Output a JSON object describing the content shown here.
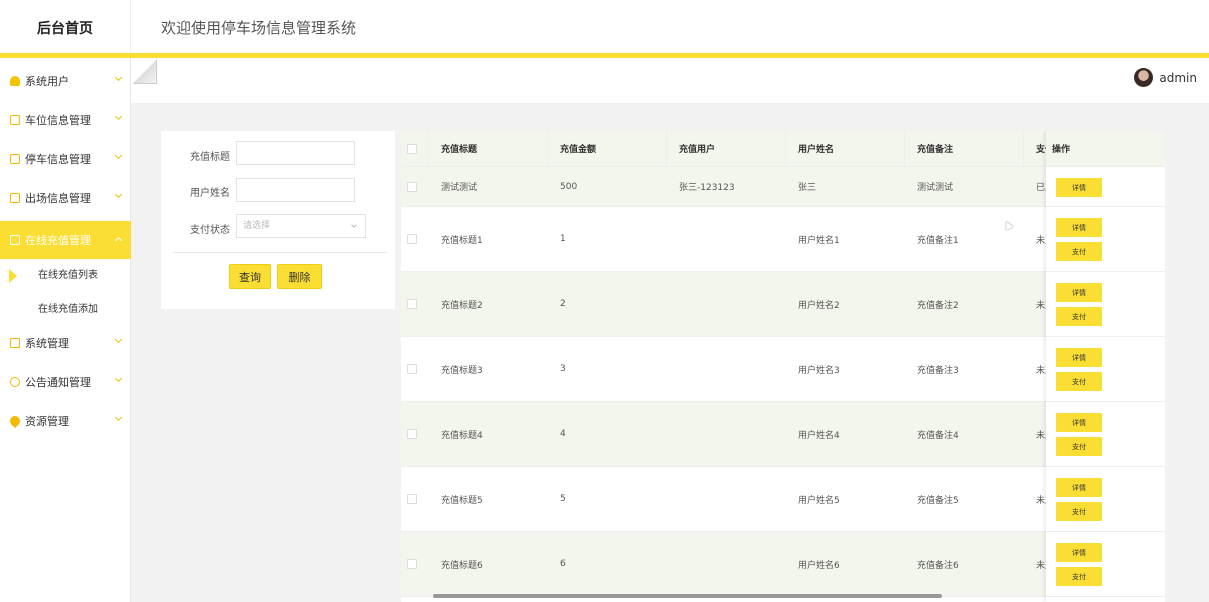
{
  "header": {
    "logo_text": "后台首页",
    "site_title": "欢迎使用停车场信息管理系统"
  },
  "user": {
    "name": "admin"
  },
  "sidebar": {
    "items": [
      {
        "label": "系统用户",
        "icon": "user-icon"
      },
      {
        "label": "车位信息管理",
        "icon": "square-icon"
      },
      {
        "label": "停车信息管理",
        "icon": "square-icon"
      },
      {
        "label": "出场信息管理",
        "icon": "square-icon"
      },
      {
        "label": "在线充值管理",
        "icon": "square-icon",
        "active": true
      },
      {
        "label": "系统管理",
        "icon": "image-icon"
      },
      {
        "label": "公告通知管理",
        "icon": "info-icon"
      },
      {
        "label": "资源管理",
        "icon": "pin-icon"
      }
    ],
    "sub_items": [
      {
        "label": "在线充值列表",
        "active": true
      },
      {
        "label": "在线充值添加"
      }
    ]
  },
  "search": {
    "title_label": "充值标题",
    "username_label": "用户姓名",
    "pay_status_label": "支付状态",
    "pay_status_placeholder": "请选择",
    "query_button": "查询",
    "delete_button": "删除"
  },
  "table": {
    "headers": [
      "充值标题",
      "充值金额",
      "充值用户",
      "用户姓名",
      "充值备注",
      "支付",
      "操作"
    ],
    "rows": [
      {
        "title": "测试测试",
        "amount": "500",
        "user": "张三-123123",
        "name": "张三",
        "remark": "测试测试",
        "pay": "已支",
        "actions": [
          "详情"
        ]
      },
      {
        "title": "充值标题1",
        "amount": "1",
        "user": "",
        "name": "用户姓名1",
        "remark": "充值备注1",
        "pay": "未支",
        "actions": [
          "详情",
          "支付"
        ]
      },
      {
        "title": "充值标题2",
        "amount": "2",
        "user": "",
        "name": "用户姓名2",
        "remark": "充值备注2",
        "pay": "未支",
        "actions": [
          "详情",
          "支付"
        ]
      },
      {
        "title": "充值标题3",
        "amount": "3",
        "user": "",
        "name": "用户姓名3",
        "remark": "充值备注3",
        "pay": "未支",
        "actions": [
          "详情",
          "支付"
        ]
      },
      {
        "title": "充值标题4",
        "amount": "4",
        "user": "",
        "name": "用户姓名4",
        "remark": "充值备注4",
        "pay": "未支",
        "actions": [
          "详情",
          "支付"
        ]
      },
      {
        "title": "充值标题5",
        "amount": "5",
        "user": "",
        "name": "用户姓名5",
        "remark": "充值备注5",
        "pay": "未支",
        "actions": [
          "详情",
          "支付"
        ]
      },
      {
        "title": "充值标题6",
        "amount": "6",
        "user": "",
        "name": "用户姓名6",
        "remark": "充值备注6",
        "pay": "未支",
        "actions": [
          "详情",
          "支付"
        ]
      }
    ]
  },
  "colors": {
    "accent": "#fbde33",
    "row_alt": "#f3f6ec"
  }
}
